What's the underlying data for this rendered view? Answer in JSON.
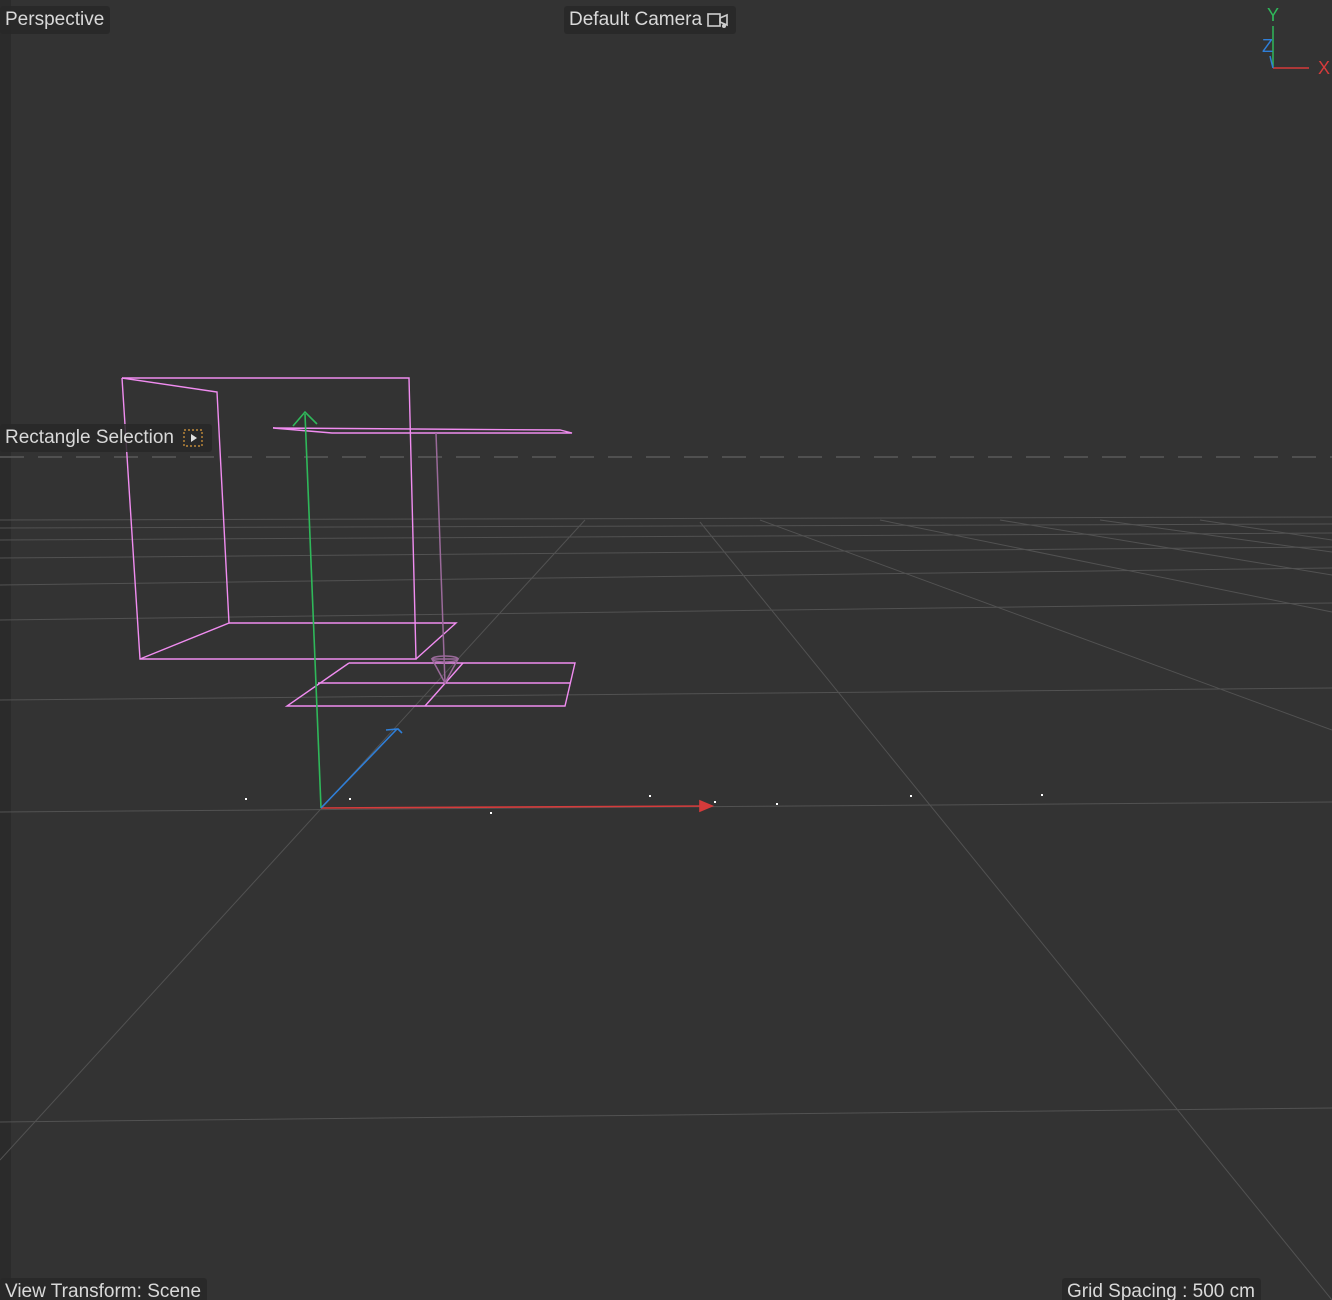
{
  "viewport": {
    "view_name": "Perspective",
    "camera_name": "Default Camera",
    "tool_name": "Rectangle Selection",
    "view_transform": "View Transform: Scene",
    "grid_spacing": "Grid Spacing : 500 cm"
  },
  "axis_gizmo": {
    "y_label": "Y",
    "z_label": "Z",
    "x_label": "X"
  },
  "colors": {
    "background": "#333333",
    "grid": "#555555",
    "wireframe": "#f08cf0",
    "axis_x": "#d63b3b",
    "axis_y": "#2fb85a",
    "axis_z": "#2f7fd8",
    "light_line": "#9a6a9a"
  },
  "icons": {
    "camera": "camera-icon",
    "selection": "rectangle-selection-icon"
  }
}
